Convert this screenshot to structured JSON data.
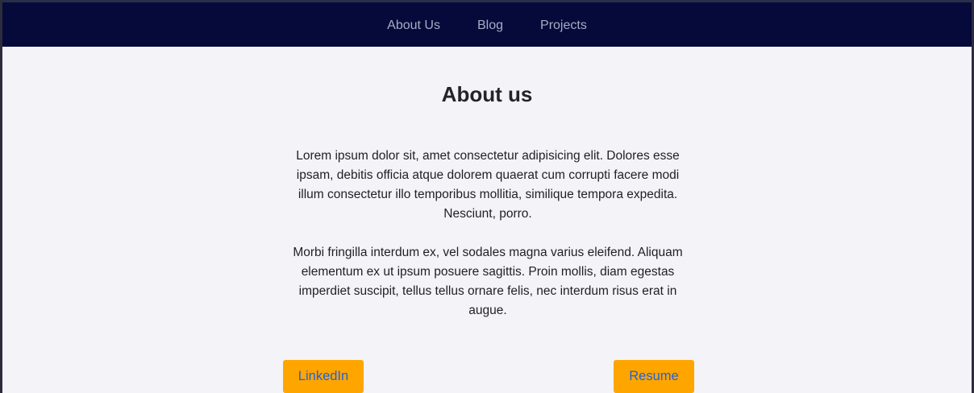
{
  "nav": {
    "items": [
      {
        "label": "About Us"
      },
      {
        "label": "Blog"
      },
      {
        "label": "Projects"
      }
    ]
  },
  "about": {
    "title": "About us",
    "paragraph_1": "Lorem ipsum dolor sit, amet consectetur adipisicing elit. Dolores esse ipsam, debitis officia atque dolorem quaerat cum corrupti facere modi illum consectetur illo temporibus mollitia, similique tempora expedita. Nesciunt, porro.",
    "paragraph_2": "Morbi fringilla interdum ex, vel sodales magna varius eleifend. Aliquam elementum ex ut ipsum posuere sagittis. Proin mollis, diam egestas imperdiet suscipit, tellus tellus ornare felis, nec interdum risus erat in augue."
  },
  "buttons": {
    "linkedin_label": "LinkedIn",
    "resume_label": "Resume"
  },
  "colors": {
    "navbar_bg": "#050a3a",
    "nav_text": "#a7acc4",
    "page_bg": "#f4f3f8",
    "button_bg": "#ffa500",
    "button_text": "#1f62d6"
  }
}
